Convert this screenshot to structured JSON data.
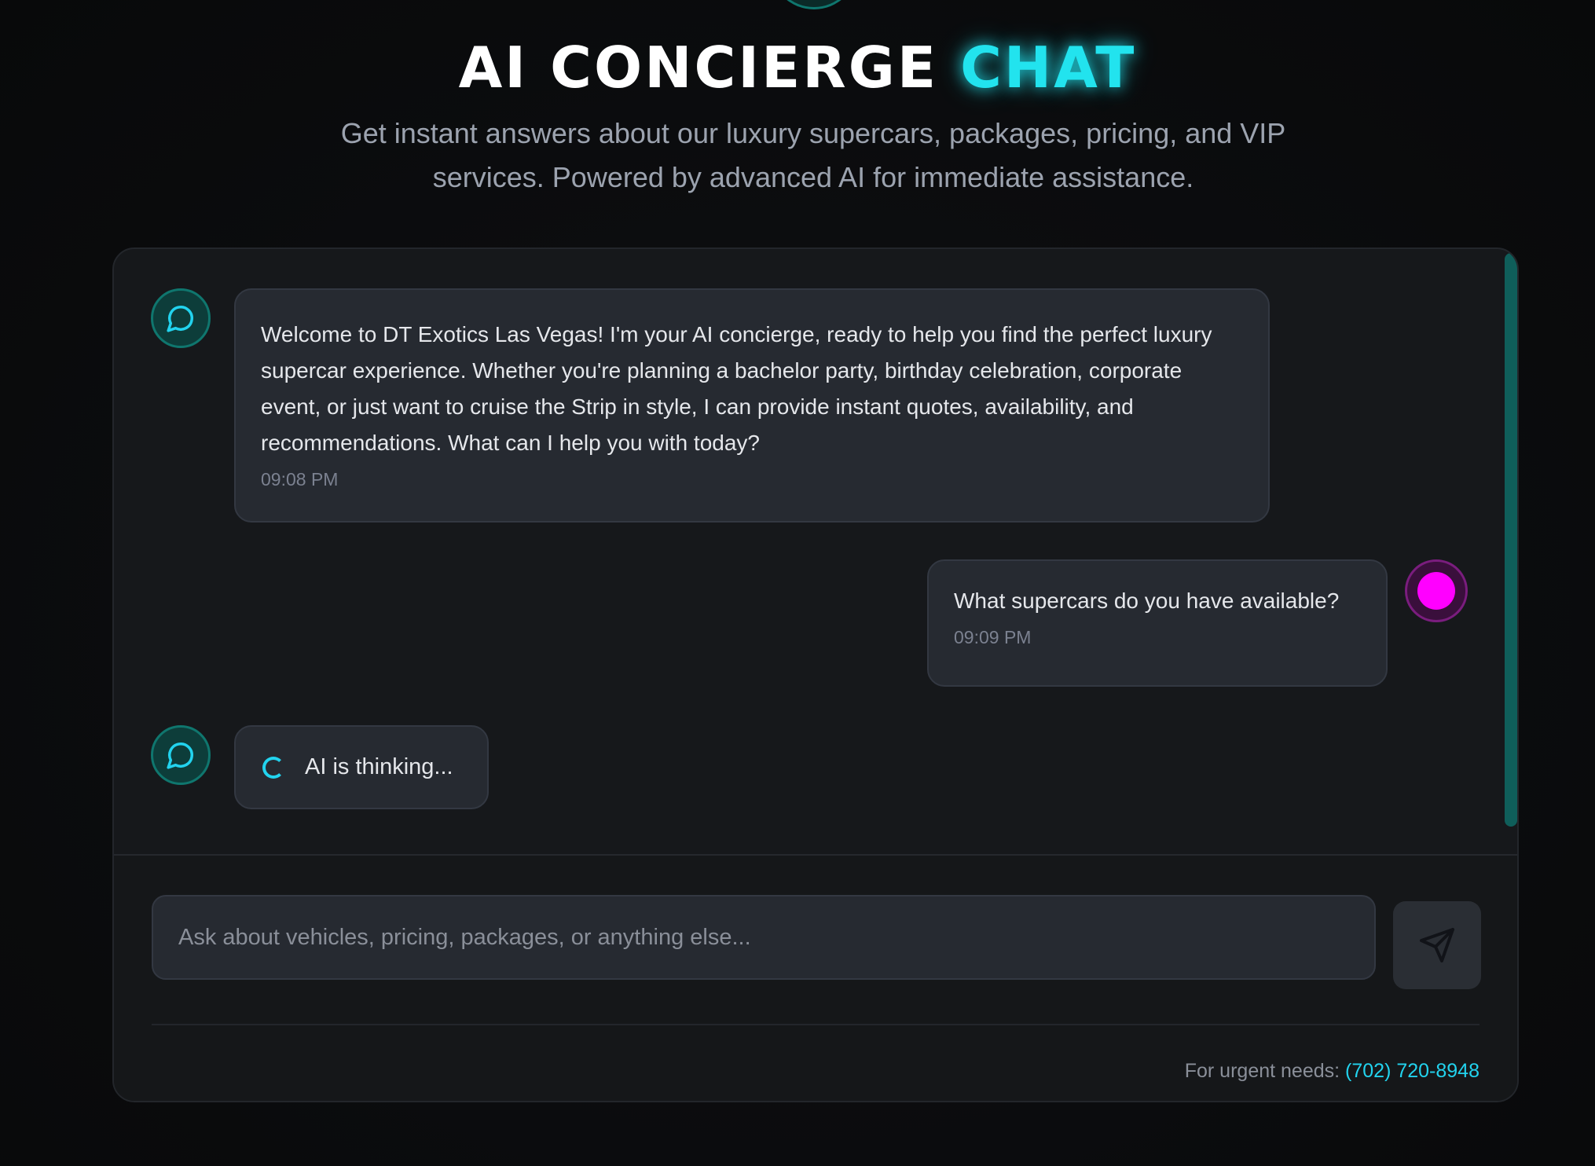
{
  "header": {
    "title_main": "AI CONCIERGE",
    "title_accent": "CHAT",
    "subtitle": "Get instant answers about our luxury supercars, packages, pricing, and VIP services. Powered by advanced AI for immediate assistance."
  },
  "messages": [
    {
      "role": "assistant",
      "text": "Welcome to DT Exotics Las Vegas! I'm your AI concierge, ready to help you find the perfect luxury supercar experience. Whether you're planning a bachelor party, birthday celebration, corporate event, or just want to cruise the Strip in style, I can provide instant quotes, availability, and recommendations. What can I help you with today?",
      "time": "09:08 PM",
      "avatar_icon": "chat-bubble-icon"
    },
    {
      "role": "user",
      "text": "What supercars do you have available?",
      "time": "09:09 PM"
    }
  ],
  "thinking": {
    "text": "AI is thinking...",
    "icon": "spinner-icon"
  },
  "composer": {
    "placeholder": "Ask about vehicles, pricing, packages, or anything else...",
    "value": "",
    "send_icon": "send-icon"
  },
  "footer": {
    "label": "For urgent needs:",
    "phone": "(702) 720-8948"
  },
  "colors": {
    "accent": "#22e3ee",
    "user_avatar": "#ff00ff",
    "bot_avatar_border": "#0f766e",
    "bubble_bg": "#262a31"
  }
}
